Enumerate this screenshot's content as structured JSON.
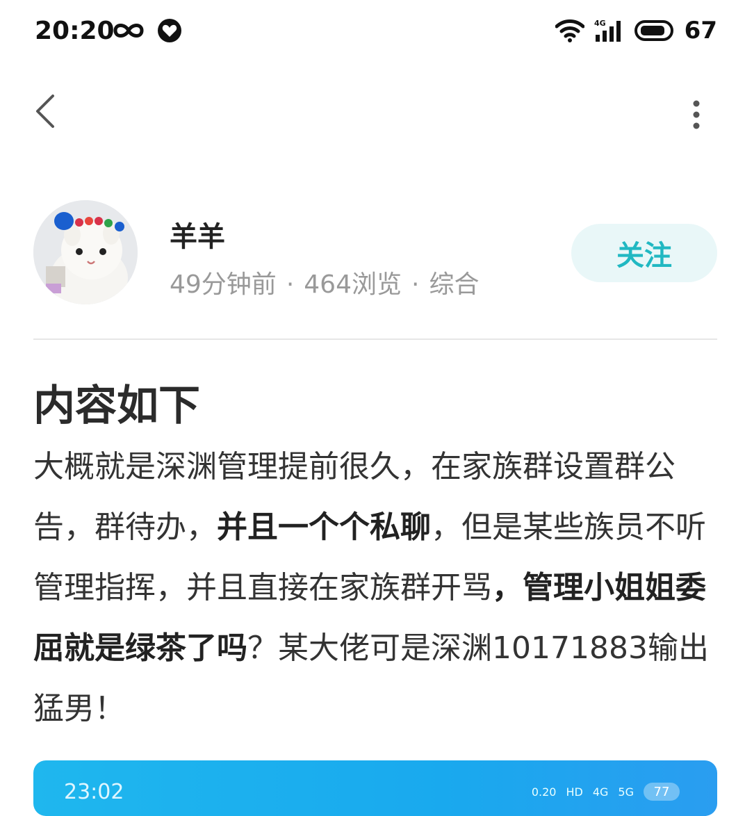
{
  "status_bar": {
    "time": "20:20",
    "battery": "67",
    "network": "4G"
  },
  "author": {
    "name": "羊羊",
    "time_ago": "49分钟前",
    "views": "464浏览",
    "category": "综合",
    "separator": "·",
    "follow_label": "关注"
  },
  "post": {
    "title": "内容如下",
    "body": [
      {
        "text": "大概就是深渊管理提前很久，在家族群设置群公告，群待办，",
        "bold": false
      },
      {
        "text": "并且一个个私聊",
        "bold": true
      },
      {
        "text": "，但是某些族员不听管理指挥，并且直接在家族群开骂",
        "bold": false
      },
      {
        "text": "，管理小姐姐委屈就是绿茶了吗",
        "bold": true
      },
      {
        "text": "？某大佬可是深渊10171883输出猛男！",
        "bold": false
      }
    ]
  },
  "image_preview": {
    "time": "23:02",
    "speed": "0.20",
    "hd": "HD",
    "net1": "4G",
    "net2": "5G",
    "battery": "77"
  },
  "colors": {
    "accent": "#21b8c2",
    "follow_bg": "#e9f7f8",
    "meta": "#999999"
  }
}
